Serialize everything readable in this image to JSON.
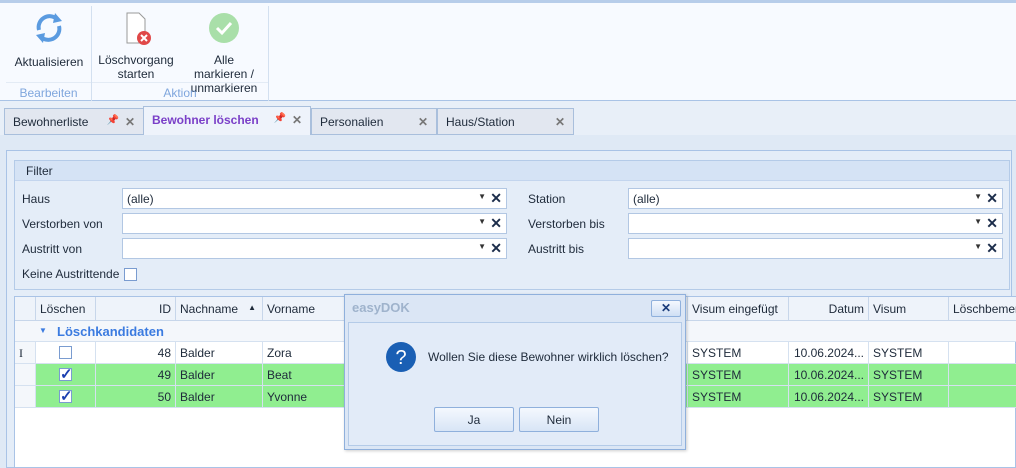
{
  "ribbon": {
    "groups": [
      {
        "label": "Bearbeiten",
        "buttons": [
          {
            "label": "Aktualisieren",
            "icon": "refresh-icon"
          }
        ]
      },
      {
        "label": "Aktion",
        "buttons": [
          {
            "label": "Löschvorgang starten",
            "icon": "delete-document-icon"
          },
          {
            "label": "Alle markieren / unmarkieren",
            "icon": "checkmark-circle-icon"
          }
        ]
      }
    ]
  },
  "tabs": [
    {
      "label": "Bewohnerliste",
      "active": false
    },
    {
      "label": "Bewohner löschen",
      "active": true
    },
    {
      "label": "Personalien",
      "active": false
    },
    {
      "label": "Haus/Station",
      "active": false
    }
  ],
  "filter": {
    "title": "Filter",
    "haus": {
      "label": "Haus",
      "value": "(alle)"
    },
    "station": {
      "label": "Station",
      "value": "(alle)"
    },
    "verstorben_von": {
      "label": "Verstorben von",
      "value": ""
    },
    "verstorben_bis": {
      "label": "Verstorben bis",
      "value": ""
    },
    "austritt_von": {
      "label": "Austritt von",
      "value": ""
    },
    "austritt_bis": {
      "label": "Austritt bis",
      "value": ""
    },
    "keine_austrittende": {
      "label": "Keine Austrittende",
      "checked": false
    }
  },
  "grid": {
    "columns": [
      "Löschen",
      "ID",
      "Nachname",
      "Vorname",
      "Visum eingefügt",
      "Datum",
      "Visum",
      "Löschbemer"
    ],
    "sort": {
      "column": "Nachname",
      "direction": "ascending"
    },
    "group": "Löschkandidaten",
    "rows": [
      {
        "checked": false,
        "id": "48",
        "nachname": "Balder",
        "vorname": "Zora",
        "visum_eingefuegt": "SYSTEM",
        "datum": "10.06.2024...",
        "visum": "SYSTEM",
        "bemerkung": ""
      },
      {
        "checked": true,
        "id": "49",
        "nachname": "Balder",
        "vorname": "Beat",
        "visum_eingefuegt": "SYSTEM",
        "datum": "10.06.2024...",
        "visum": "SYSTEM",
        "bemerkung": ""
      },
      {
        "checked": true,
        "id": "50",
        "nachname": "Balder",
        "vorname": "Yvonne",
        "visum_eingefuegt": "SYSTEM",
        "datum": "10.06.2024...",
        "visum": "SYSTEM",
        "bemerkung": ""
      }
    ],
    "highlight_color": "#90ee90"
  },
  "dialog": {
    "title": "easyDOK",
    "message": "Wollen Sie diese Bewohner wirklich löschen?",
    "icon": "question-icon",
    "yes": "Ja",
    "no": "Nein"
  }
}
